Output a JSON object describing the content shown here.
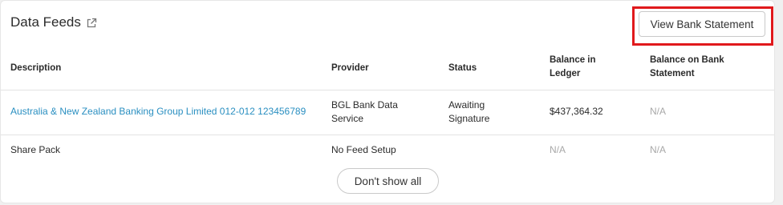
{
  "header": {
    "title": "Data Feeds",
    "view_bank_statement_label": "View Bank Statement"
  },
  "table": {
    "columns": [
      "Description",
      "Provider",
      "Status",
      "Balance in Ledger",
      "Balance on Bank Statement"
    ],
    "rows": [
      {
        "description": "Australia & New Zealand Banking Group Limited 012-012 123456789",
        "provider": "BGL Bank Data Service",
        "status": "Awaiting Signature",
        "balance_ledger": "$437,364.32",
        "balance_statement": "N/A"
      },
      {
        "description": "Share Pack",
        "provider": "No Feed Setup",
        "status": "",
        "balance_ledger": "N/A",
        "balance_statement": "N/A"
      }
    ]
  },
  "footer": {
    "dont_show_all_label": "Don't show all"
  },
  "colors": {
    "link": "#2a8fc1",
    "highlight": "#e0191c",
    "muted": "#a8a8a8"
  },
  "icons": {
    "title_icon": "external-link-icon"
  }
}
